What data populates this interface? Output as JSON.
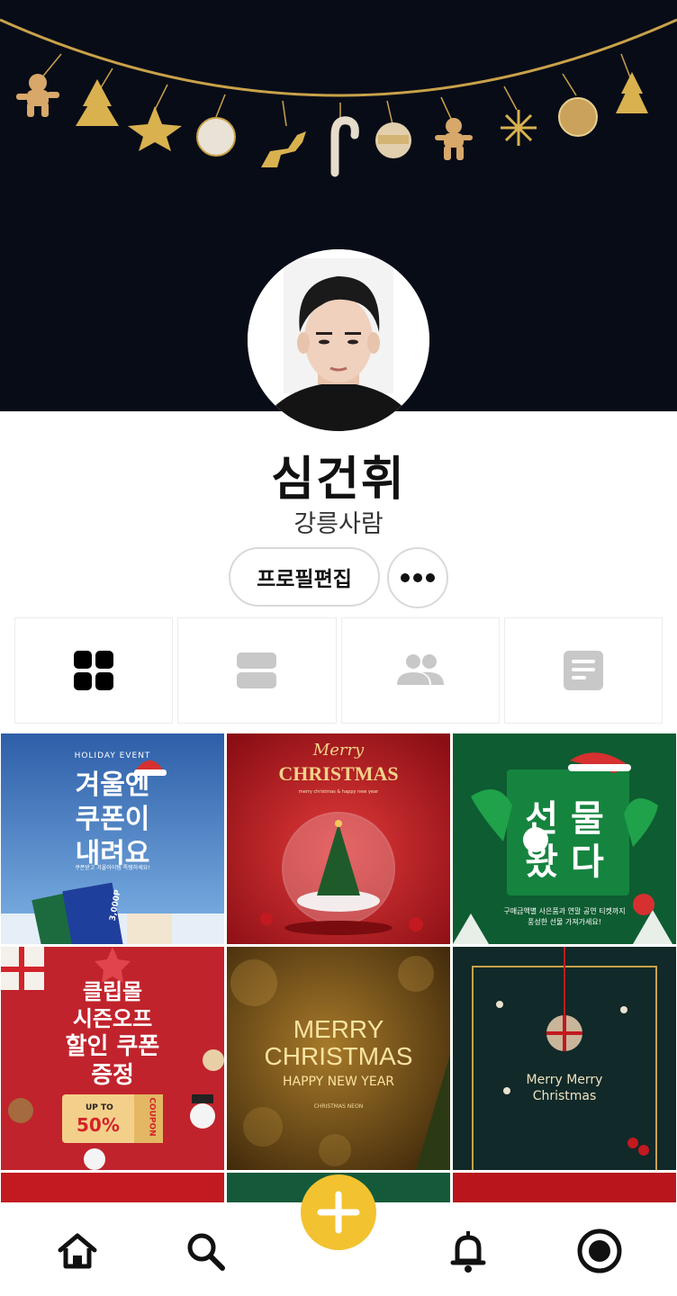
{
  "profile": {
    "name": "심건휘",
    "bio": "강릉사람",
    "edit_label": "프로필편집"
  },
  "tabs": [
    {
      "icon": "grid-icon",
      "active": true
    },
    {
      "icon": "list-view-icon",
      "active": false
    },
    {
      "icon": "friends-icon",
      "active": false
    },
    {
      "icon": "document-icon",
      "active": false
    }
  ],
  "posts": {
    "p1": {
      "event": "HOLIDAY EVENT",
      "line1": "겨울엔",
      "line2": "쿠폰이",
      "line3": "내려요",
      "sub": "쿠폰받고 겨울아이템 특템하세요!",
      "coupon": "3,000P"
    },
    "p2": {
      "script": "Merry",
      "title": "CHRISTMAS",
      "sub": "merry christmas & happy new year"
    },
    "p3": {
      "line1": "선 물",
      "line2": "왔 다",
      "sub1": "구매금액별 사은품과 연말 공연 티켓까지",
      "sub2": "풍성한 선물 가져가세요!"
    },
    "p4": {
      "line1": "클립몰",
      "line2": "시즌오프",
      "line3": "할인 쿠폰",
      "line4": "증정",
      "upto": "UP TO",
      "pct": "50%",
      "coupon": "COUPON"
    },
    "p5": {
      "line1": "MERRY",
      "line2": "CHRISTMAS",
      "line3": "HAPPY NEW YEAR",
      "sub": "CHRISTMAS NEON"
    },
    "p6": {
      "line1": "Merry Merry",
      "line2": "Christmas"
    }
  },
  "colors": {
    "accent": "#f2c230",
    "cover_bg": "#080c17",
    "active_icon": "#000000",
    "inactive_icon": "#c8c8c8"
  }
}
